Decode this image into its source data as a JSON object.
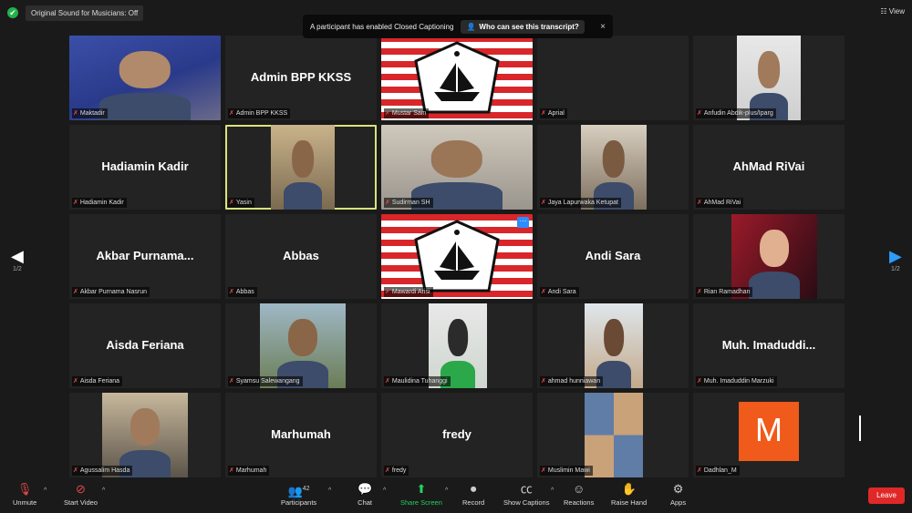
{
  "topbar": {
    "original_sound": "Original Sound for Musicians: Off",
    "view_label": "View"
  },
  "caption_notice": {
    "text": "A participant has enabled Closed Captioning",
    "who_button": "Who can see this transcript?",
    "close": "×"
  },
  "tiles": [
    {
      "name": "Maktadir",
      "big": "",
      "photo": "man-blue"
    },
    {
      "name": "Admin BPP KKSS",
      "big": "Admin BPP KKSS",
      "photo": ""
    },
    {
      "name": "Mustar Sain",
      "big": "",
      "photo": "kkss-logo"
    },
    {
      "name": "Aprial",
      "big": "",
      "photo": ""
    },
    {
      "name": "Anfudin Abdik-plus/Iparg",
      "big": "",
      "photo": "man-small"
    },
    {
      "name": "Hadiamin Kadir",
      "big": "Hadiamin Kadir",
      "photo": ""
    },
    {
      "name": "Yasin",
      "big": "",
      "photo": "man-glasses",
      "active": true
    },
    {
      "name": "Sudirman SH",
      "big": "",
      "photo": "man-laptop"
    },
    {
      "name": "Jaya Lapurwaka Ketupat",
      "big": "",
      "photo": "man-room"
    },
    {
      "name": "AhMad RiVai",
      "big": "AhMad RiVai",
      "photo": ""
    },
    {
      "name": "Akbar Purnama Nasrun",
      "big": "Akbar Purnama...",
      "photo": ""
    },
    {
      "name": "Abbas",
      "big": "Abbas",
      "photo": ""
    },
    {
      "name": "Mawardi Arisi",
      "big": "",
      "photo": "kkss-logo",
      "more": "···"
    },
    {
      "name": "Andi Sara",
      "big": "Andi Sara",
      "photo": ""
    },
    {
      "name": "Rian Ramadhan",
      "big": "",
      "photo": "poster"
    },
    {
      "name": "Aisda Feriana",
      "big": "Aisda Feriana",
      "photo": ""
    },
    {
      "name": "Syamsu Salewangang",
      "big": "",
      "photo": "man-thumb"
    },
    {
      "name": "Maulidina Tuhanggi",
      "big": "",
      "photo": "woman-hijab"
    },
    {
      "name": "ahmad hunniawan",
      "big": "",
      "photo": "man-beach"
    },
    {
      "name": "Muh. Imaduddin Marzuki",
      "big": "Muh. Imaduddi...",
      "photo": ""
    },
    {
      "name": "Agussalim Hasda",
      "big": "",
      "photo": "man-suit"
    },
    {
      "name": "Marhumah",
      "big": "Marhumah",
      "photo": ""
    },
    {
      "name": "fredy",
      "big": "fredy",
      "photo": ""
    },
    {
      "name": "Muslimin Mawi",
      "big": "",
      "photo": "collage"
    },
    {
      "name": "Dadhlan_M",
      "big": "",
      "photo": "letter-m",
      "letter": "M"
    }
  ],
  "pager": {
    "left": "1/2",
    "right": "1/2"
  },
  "toolbar": {
    "unmute": "Unmute",
    "start_video": "Start Video",
    "participants": "Participants",
    "participants_count": "42",
    "chat": "Chat",
    "share_screen": "Share Screen",
    "record": "Record",
    "show_captions": "Show Captions",
    "reactions": "Reactions",
    "raise_hand": "Raise Hand",
    "apps": "Apps",
    "leave": "Leave"
  },
  "colors": {
    "accent_green": "#23d160",
    "leave_red": "#e02828",
    "active_border": "#d9e37a",
    "blue": "#2d8cff"
  }
}
